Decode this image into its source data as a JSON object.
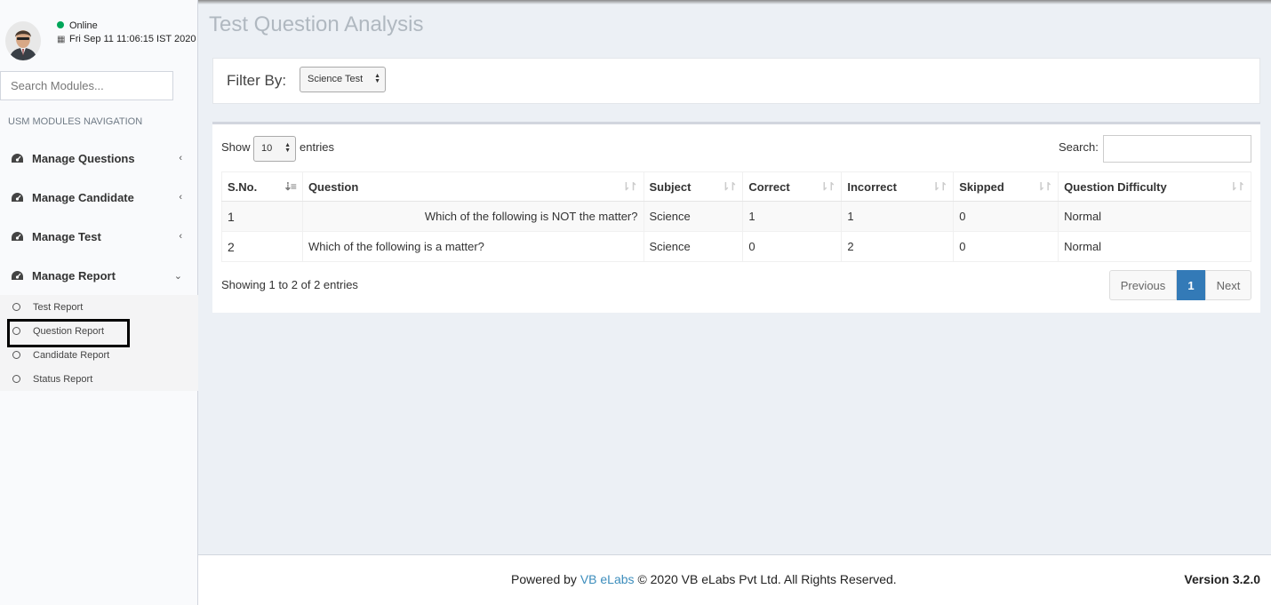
{
  "user": {
    "status": "Online",
    "status_color": "#00a65a",
    "datetime": "Fri Sep 11 11:06:15 IST 2020"
  },
  "sidebar": {
    "search_placeholder": "Search Modules...",
    "nav_header": "USM MODULES NAVIGATION",
    "menu": [
      {
        "label": "Manage Questions",
        "icon": "dashboard-icon",
        "chevron": "‹"
      },
      {
        "label": "Manage Candidate",
        "icon": "dashboard-icon",
        "chevron": "‹"
      },
      {
        "label": "Manage Test",
        "icon": "dashboard-icon",
        "chevron": "‹"
      },
      {
        "label": "Manage Report",
        "icon": "dashboard-icon",
        "chevron": "⌄"
      }
    ],
    "submenu": [
      {
        "label": "Test Report"
      },
      {
        "label": "Question Report"
      },
      {
        "label": "Candidate Report"
      },
      {
        "label": "Status Report"
      }
    ]
  },
  "main": {
    "title": "Test Question Analysis",
    "filter": {
      "label": "Filter By:",
      "selected": "Science Test"
    },
    "table_controls": {
      "show": "Show",
      "length": "10",
      "entries": "entries",
      "search": "Search:"
    },
    "table": {
      "headers": [
        "S.No.",
        "Question",
        "Subject",
        "Correct",
        "Incorrect",
        "Skipped",
        "Question Difficulty"
      ],
      "rows": [
        [
          "1",
          "Which of the following is NOT the matter?",
          "Science",
          "1",
          "1",
          "0",
          "Normal"
        ],
        [
          "2",
          "Which of the following is a matter?",
          "Science",
          "0",
          "2",
          "0",
          "Normal"
        ]
      ]
    },
    "info": "Showing 1 to 2 of 2 entries",
    "pagination": {
      "previous": "Previous",
      "current": "1",
      "next": "Next"
    }
  },
  "footer": {
    "powered_by": "Powered by",
    "link": "VB eLabs",
    "copyright": "© 2020 VB eLabs Pvt Ltd. All Rights Reserved.",
    "version": "Version 3.2.0"
  },
  "colors": {
    "accent": "#337ab7",
    "link": "#3c8dbc",
    "online": "#00a65a"
  }
}
